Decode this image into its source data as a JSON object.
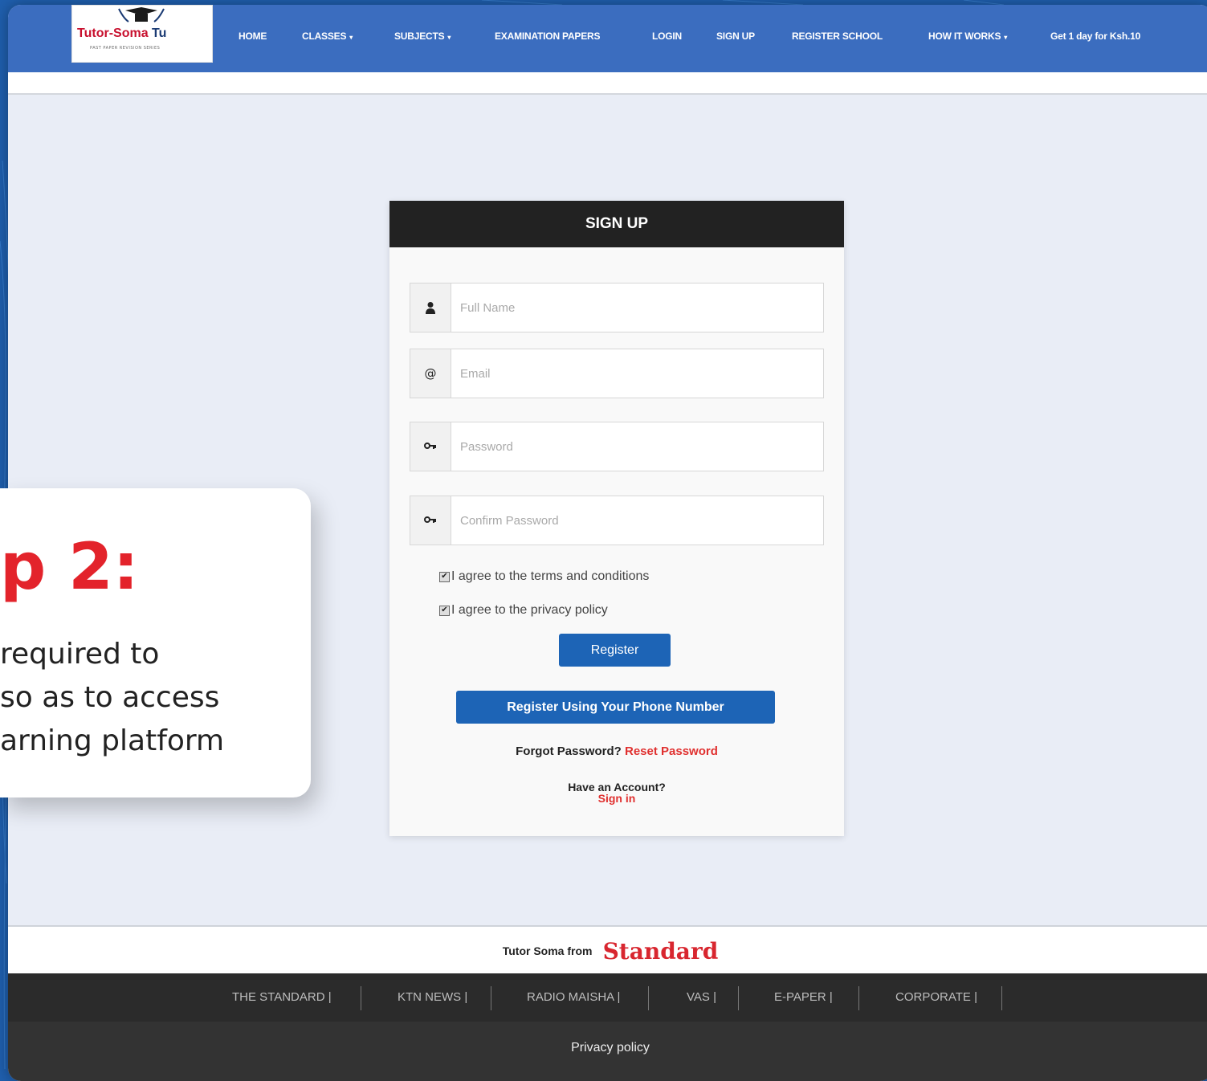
{
  "nav": {
    "logo_text_red": "Tutor-Soma",
    "logo_text_dark": " Tu",
    "logo_subtitle": "PAST PAPER REVISION SERIES",
    "items": [
      {
        "label": "HOME",
        "dropdown": false
      },
      {
        "label": "CLASSES",
        "dropdown": true
      },
      {
        "label": "SUBJECTS",
        "dropdown": true
      },
      {
        "label": "EXAMINATION PAPERS",
        "dropdown": false
      },
      {
        "label": "LOGIN",
        "dropdown": false
      },
      {
        "label": "SIGN UP",
        "dropdown": false
      },
      {
        "label": "REGISTER SCHOOL",
        "dropdown": false
      },
      {
        "label": "HOW IT WORKS",
        "dropdown": true
      },
      {
        "label": "Get 1 day for Ksh.10",
        "dropdown": false
      }
    ],
    "caret": "▾"
  },
  "signup": {
    "title": "SIGN UP",
    "fields": [
      {
        "icon": "user-icon",
        "placeholder": "Full Name"
      },
      {
        "icon": "at-icon",
        "placeholder": "Email"
      },
      {
        "icon": "key-icon",
        "placeholder": "Password"
      },
      {
        "icon": "key-icon",
        "placeholder": "Confirm Password"
      }
    ],
    "checks": [
      {
        "label": "I agree to the terms and conditions",
        "checked": true
      },
      {
        "label": "I agree to the privacy policy",
        "checked": true
      }
    ],
    "register_label": "Register",
    "phone_label": "Register Using Your Phone Number",
    "forgot_text": "Forgot Password?",
    "reset_link": "Reset Password",
    "have_account": "Have an Account?",
    "signin_link": "Sign in"
  },
  "footer": {
    "brand_prefix": "Tutor Soma from",
    "brand_name": "Standard",
    "links": [
      "THE STANDARD |",
      "KTN NEWS |",
      "RADIO MAISHA |",
      "VAS |",
      "E-PAPER |",
      "CORPORATE |"
    ],
    "privacy": "Privacy policy"
  },
  "step": {
    "title": "p 2:",
    "description": "required to\nso as to access\narning platform"
  },
  "colors": {
    "nav_bg": "#3b6dbf",
    "accent_blue": "#1d64b6",
    "accent_red": "#e3232b",
    "card_header": "#222222"
  }
}
